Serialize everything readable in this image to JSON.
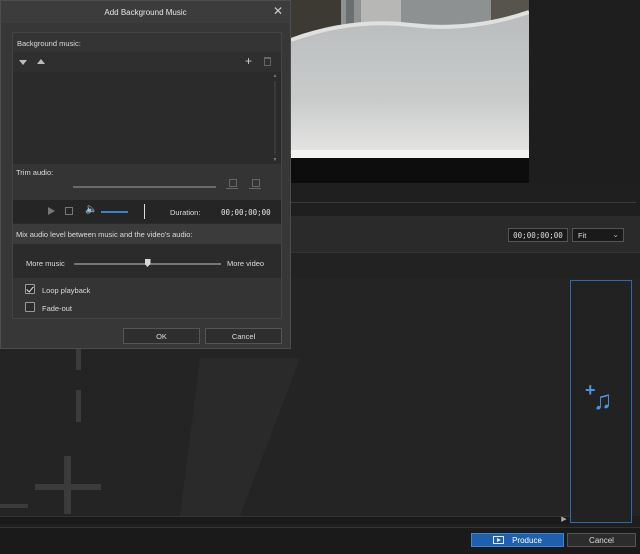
{
  "dialog": {
    "title": "Add Background Music",
    "background_music_label": "Background music:",
    "trim_audio_label": "Trim audio:",
    "duration_label": "Duration:",
    "duration_value": "00;00;00;00",
    "mix_label": "Mix audio level between music and the video's audio:",
    "more_music_label": "More music",
    "more_video_label": "More video",
    "mix_level": 0.5,
    "loop_playback": {
      "label": "Loop playback",
      "checked": true
    },
    "fade_out": {
      "label": "Fade-out",
      "checked": false
    },
    "ok_label": "OK",
    "cancel_label": "Cancel",
    "close_glyph": "✕"
  },
  "editor": {
    "timecode": "00;00;00;00",
    "fit_select": "Fit",
    "produce_label": "Produce",
    "cancel_label": "Cancel"
  },
  "colors": {
    "accent": "#1e5fae",
    "accent_light": "#4a94de",
    "dialog_bg": "#373737",
    "app_bg": "#1e1e1e"
  },
  "icons": [
    "close-icon",
    "move-down-icon",
    "move-up-icon",
    "add-icon",
    "delete-icon",
    "mark-in-icon",
    "mark-out-icon",
    "play-icon",
    "stop-icon",
    "volume-icon",
    "checkmark-icon",
    "add-music-icon",
    "produce-icon"
  ]
}
